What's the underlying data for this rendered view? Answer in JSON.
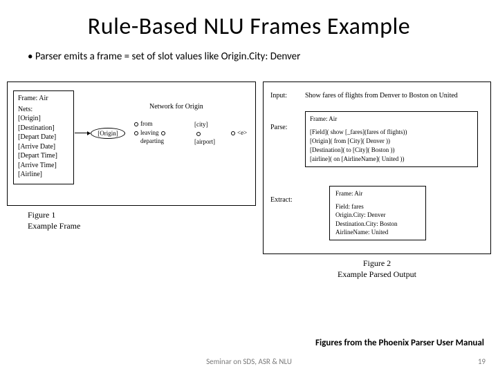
{
  "slide": {
    "title": "Rule-Based NLU Frames Example",
    "bullet": "Parser emits a frame = set of slot values like Origin.City: Denver",
    "credit": "Figures from the Phoenix Parser User Manual",
    "footer": "Seminar on SDS, ASR & NLU",
    "page": "19"
  },
  "figure1": {
    "caption_num": "Figure 1",
    "caption_text": "Example Frame",
    "frame_header": "Frame: Air",
    "nets_label": "Nets:",
    "slots": [
      "[Origin]",
      "[Destination]",
      "[Depart Date]",
      "[Arrive Date]",
      "[Depart Time]",
      "[Arrive Time]",
      "[Airline]"
    ],
    "origin_node": "[Origin]",
    "network_title": "Network for Origin",
    "transitions": [
      "from",
      "leaving",
      "departing"
    ],
    "targets": [
      "[city]",
      "[airport]"
    ],
    "epsilon": "<e>"
  },
  "figure2": {
    "caption_num": "Figure 2",
    "caption_text": "Example Parsed Output",
    "input_label": "Input:",
    "input_text": "Show fares of flights from Denver to Boston on United",
    "parse_label": "Parse:",
    "parse_frame": "Frame: Air",
    "parse_lines": [
      "[Field]( show [_fares](fares of flights))",
      "[Origin]( from [City]( Denver ))",
      "[Destination]( to [City]( Boston ))",
      "[airline]( on [AirlineName]( United ))"
    ],
    "extract_label": "Extract:",
    "extract_frame": "Frame: Air",
    "extract_lines": [
      "Field: fares",
      "Origin.City: Denver",
      "Destination.City: Boston",
      "AirlineName: United"
    ]
  }
}
